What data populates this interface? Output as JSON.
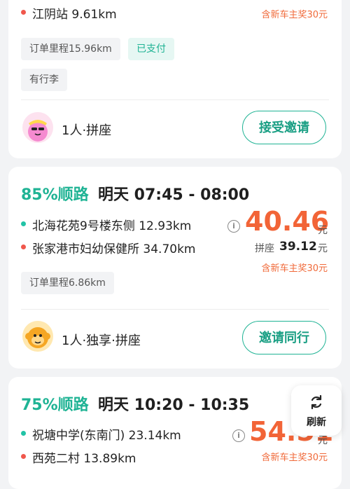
{
  "card1": {
    "dest_addr": "江阴站",
    "dest_dist": "9.61km",
    "bonus": "含新车主奖30元",
    "tags": [
      "订单里程15.96km",
      "已支付",
      "有行李"
    ],
    "seat_info": "1人·拼座",
    "action": "接受邀请"
  },
  "card2": {
    "match": "85%顺路",
    "time": "明天 07:45 - 08:00",
    "origin_addr": "北海花苑9号楼东侧",
    "origin_dist": "12.93km",
    "dest_addr": "张家港市妇幼保健所",
    "dest_dist": "34.70km",
    "price": "40.46",
    "currency": "元",
    "carpool_label": "拼座",
    "carpool_price": "39.12",
    "bonus": "含新车主奖30元",
    "tags": [
      "订单里程6.86km"
    ],
    "seat_info": "1人·独享·拼座",
    "action": "邀请同行"
  },
  "card3": {
    "match": "75%顺路",
    "time": "明天 10:20 - 10:35",
    "origin_addr": "祝塘中学(东南门)",
    "origin_dist": "23.14km",
    "dest_addr": "西苑二村",
    "dest_dist": "13.89km",
    "price": "54.51",
    "currency": "元",
    "bonus": "含新车主奖30元"
  },
  "refresh": {
    "label": "刷新"
  },
  "colors": {
    "accent": "#1fb394",
    "price": "#f26437",
    "origin_dot": "#22c3a6",
    "dest_dot": "#f0574c"
  }
}
